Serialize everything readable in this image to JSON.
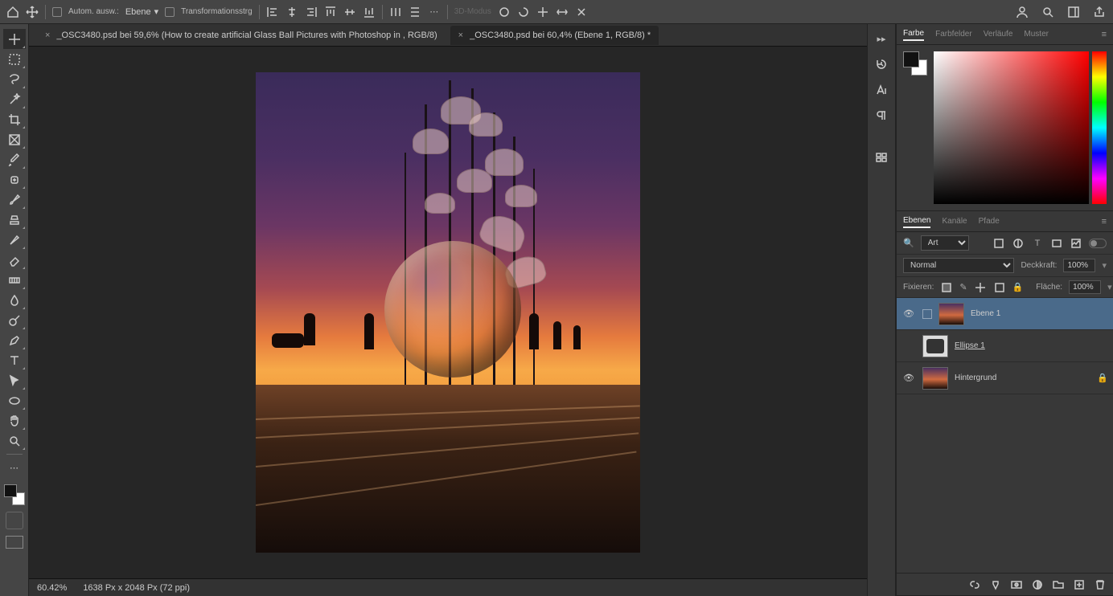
{
  "topbar": {
    "auto_select": "Autom. ausw.:",
    "target": "Ebene",
    "transform": "Transformationsstrg",
    "mode3d": "3D-Modus"
  },
  "tabs": [
    {
      "title": "_OSC3480.psd bei 59,6% (How to create artificial Glass Ball Pictures with Photoshop in , RGB/8)",
      "active": false
    },
    {
      "title": "_OSC3480.psd bei 60,4% (Ebene 1, RGB/8) *",
      "active": true
    }
  ],
  "status": {
    "zoom": "60.42%",
    "dims": "1638 Px x 2048 Px (72 ppi)"
  },
  "color_panel": {
    "tabs": [
      "Farbe",
      "Farbfelder",
      "Verläufe",
      "Muster"
    ]
  },
  "layers_panel": {
    "tabs": [
      "Ebenen",
      "Kanäle",
      "Pfade"
    ],
    "filter": "Art",
    "blend": "Normal",
    "opacity_label": "Deckkraft:",
    "opacity": "100%",
    "lock_label": "Fixieren:",
    "fill_label": "Fläche:",
    "fill": "100%",
    "layers": [
      {
        "name": "Ebene 1",
        "visible": true,
        "thumb": "sunset",
        "selected": true,
        "locked": false
      },
      {
        "name": "Ellipse 1",
        "visible": false,
        "thumb": "shape",
        "selected": false,
        "locked": false,
        "underline": true
      },
      {
        "name": "Hintergrund",
        "visible": true,
        "thumb": "sunset",
        "selected": false,
        "locked": true
      }
    ]
  }
}
